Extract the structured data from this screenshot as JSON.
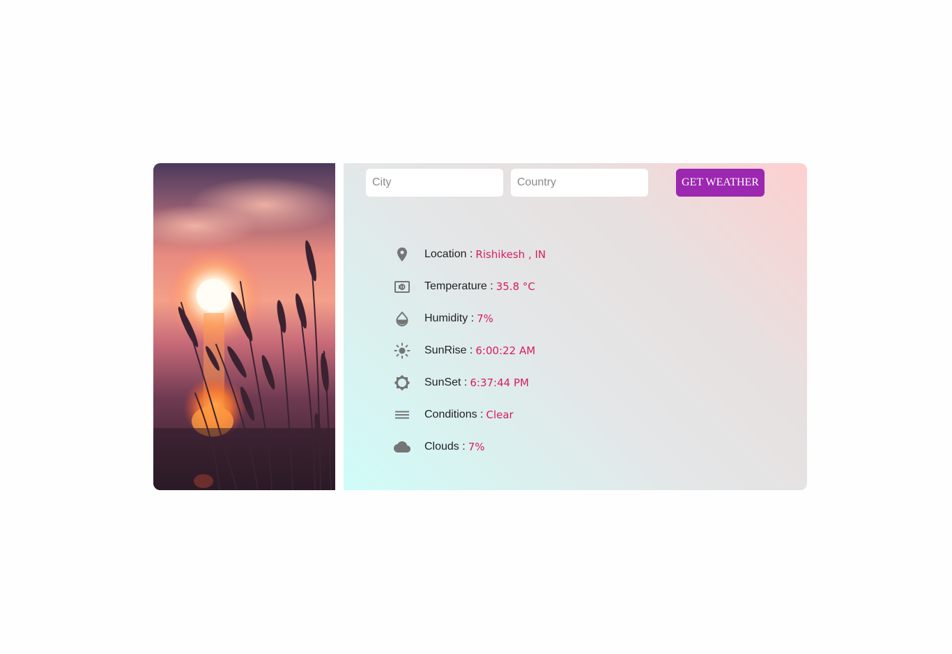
{
  "search": {
    "city_placeholder": "City",
    "country_placeholder": "Country",
    "button_label": "GET WEATHER"
  },
  "details": [
    {
      "label": "Location :",
      "value": "Rishikesh , IN",
      "icon": "location-pin-icon"
    },
    {
      "label": "Temperature :",
      "value": "35.8 °C",
      "icon": "thermostat-icon"
    },
    {
      "label": "Humidity :",
      "value": "7%",
      "icon": "water-drop-icon"
    },
    {
      "label": "SunRise :",
      "value": "6:00:22 AM",
      "icon": "sun-icon"
    },
    {
      "label": "SunSet :",
      "value": "6:37:44 PM",
      "icon": "brightness-icon"
    },
    {
      "label": "Conditions :",
      "value": "Clear",
      "icon": "menu-lines-icon"
    },
    {
      "label": "Clouds :",
      "value": "7%",
      "icon": "cloud-icon"
    }
  ],
  "colors": {
    "accent_button": "#9c27b0",
    "value_text": "#d81b60",
    "icon": "#757575"
  }
}
